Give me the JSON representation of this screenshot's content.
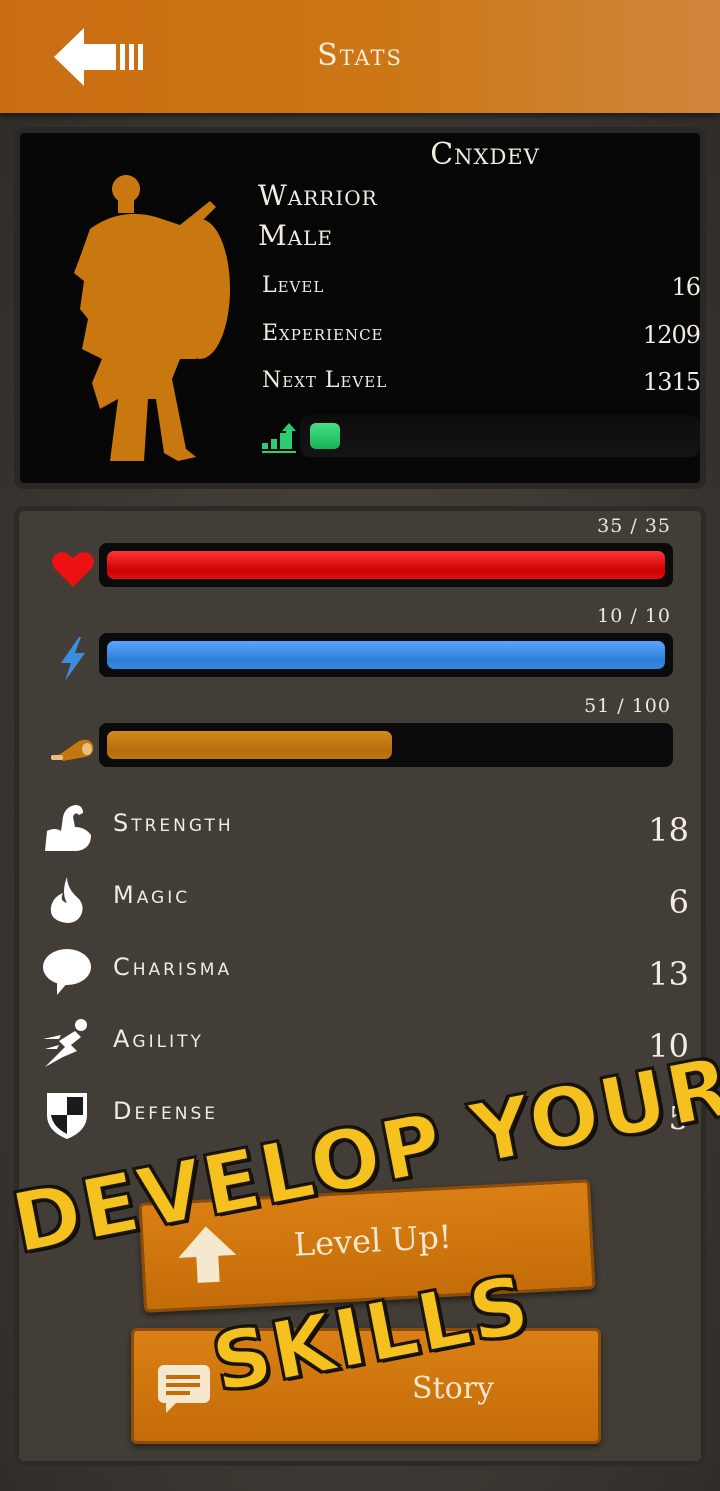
{
  "header": {
    "title": "Stats",
    "back_icon": "back-arrow-icon"
  },
  "character": {
    "name": "Cnxdev",
    "class": "Warrior",
    "gender": "Male",
    "silhouette_icon": "warrior-silhouette-icon",
    "silhouette_color": "#c8780f",
    "level_label": "Level",
    "level": "16",
    "experience_label": "Experience",
    "experience": "1209",
    "next_level_label": "Next Level",
    "next_level": "1315",
    "xp_icon": "level-up-chart-icon",
    "xp_progress": 0.08,
    "xp_color": "#2ecc71"
  },
  "vitals": {
    "health": {
      "text": "35 / 35",
      "current": 35,
      "max": 35,
      "icon": "heart-icon",
      "color": "#ee1111"
    },
    "energy": {
      "text": "10 / 10",
      "current": 10,
      "max": 10,
      "icon": "lightning-icon",
      "color": "#3a8ee0"
    },
    "food": {
      "text": "51 / 100",
      "current": 51,
      "max": 100,
      "icon": "meat-icon",
      "color": "#c27810"
    }
  },
  "attributes": [
    {
      "name": "Strength",
      "value": "18",
      "icon": "flexed-arm-icon"
    },
    {
      "name": "Magic",
      "value": "6",
      "icon": "flame-icon"
    },
    {
      "name": "Charisma",
      "value": "13",
      "icon": "speech-bubble-icon"
    },
    {
      "name": "Agility",
      "value": "10",
      "icon": "running-figure-icon"
    },
    {
      "name": "Defense",
      "value": "5",
      "icon": "shield-icon"
    }
  ],
  "buttons": {
    "level_up": "Level Up!",
    "story": "Story",
    "level_up_icon": "arrow-up-icon",
    "story_icon": "message-icon"
  },
  "promo": {
    "line1": "DEVELOP YOUR",
    "line2": "SKILLS",
    "color": "#f5c11f"
  }
}
